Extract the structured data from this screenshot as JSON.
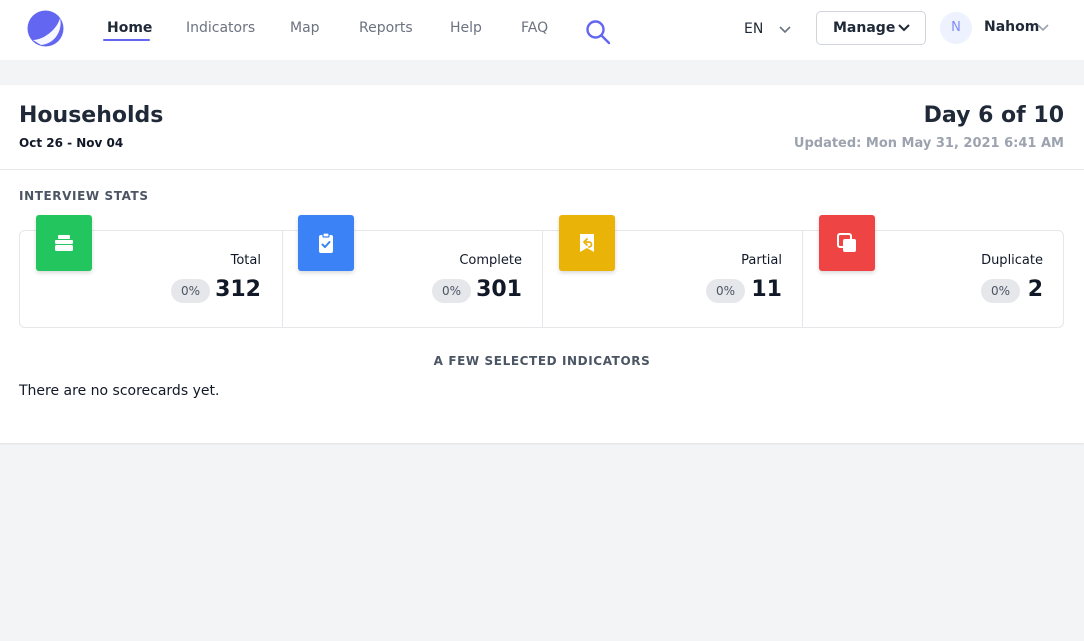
{
  "nav": {
    "logo_icon": "crescent-logo-icon",
    "links": [
      {
        "label": "Home",
        "active": true
      },
      {
        "label": "Indicators",
        "active": false
      },
      {
        "label": "Map",
        "active": false
      },
      {
        "label": "Reports",
        "active": false
      },
      {
        "label": "Help",
        "active": false
      },
      {
        "label": "FAQ",
        "active": false
      }
    ],
    "search_icon": "search-icon",
    "language": "EN",
    "manage_label": "Manage",
    "user": {
      "initial": "N",
      "name": "Nahom"
    }
  },
  "page": {
    "title": "Households",
    "date_range": "Oct 26 - Nov 04",
    "day_progress": "Day 6 of 10",
    "updated": "Updated: Mon May 31, 2021 6:41 AM"
  },
  "stats": {
    "section_label": "INTERVIEW STATS",
    "items": [
      {
        "label": "Total",
        "percent": "0%",
        "value": "312",
        "icon": "stack-icon",
        "color": "#22c55e"
      },
      {
        "label": "Complete",
        "percent": "0%",
        "value": "301",
        "icon": "clipboard-check-icon",
        "color": "#3b82f6"
      },
      {
        "label": "Partial",
        "percent": "0%",
        "value": "11",
        "icon": "undo-document-icon",
        "color": "#eab308"
      },
      {
        "label": "Duplicate",
        "percent": "0%",
        "value": "2",
        "icon": "duplicate-icon",
        "color": "#ef4444"
      }
    ]
  },
  "indicators": {
    "title": "A FEW SELECTED INDICATORS",
    "empty_message": "There are no scorecards yet."
  },
  "colors": {
    "accent": "#6366f1",
    "background": "#f3f4f6"
  }
}
